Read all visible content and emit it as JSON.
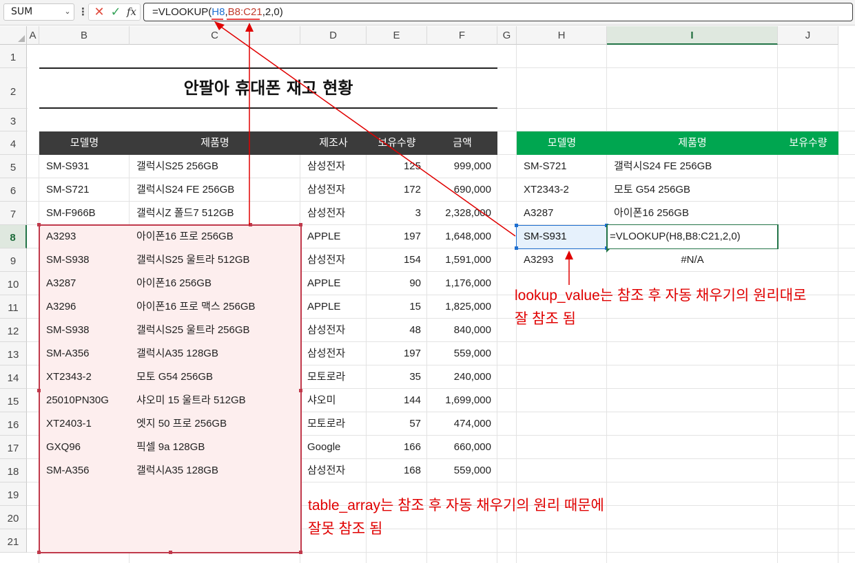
{
  "formula_bar": {
    "name_box": "SUM",
    "formula_prefix": "=VLOOKUP(",
    "ref_lookup": "H8",
    "comma1": ",",
    "ref_range": "B8:C21",
    "formula_suffix": ",2,0)"
  },
  "columns": [
    "A",
    "B",
    "C",
    "D",
    "E",
    "F",
    "G",
    "H",
    "I",
    "J"
  ],
  "rows": [
    "1",
    "2",
    "3",
    "4",
    "5",
    "6",
    "7",
    "8",
    "9",
    "10",
    "11",
    "12",
    "13",
    "14",
    "15",
    "16",
    "17",
    "18",
    "19",
    "20",
    "21"
  ],
  "title": "안팔아 휴대폰 재고 현황",
  "table1": {
    "headers": [
      "모델명",
      "제품명",
      "제조사",
      "보유수량",
      "금액"
    ],
    "rows": [
      [
        "SM-S931",
        "갤럭시S25 256GB",
        "삼성전자",
        "125",
        "999,000"
      ],
      [
        "SM-S721",
        "갤럭시S24 FE 256GB",
        "삼성전자",
        "172",
        "690,000"
      ],
      [
        "SM-F966B",
        "갤럭시Z 폴드7 512GB",
        "삼성전자",
        "3",
        "2,328,000"
      ],
      [
        "A3293",
        "아이폰16 프로 256GB",
        "APPLE",
        "197",
        "1,648,000"
      ],
      [
        "SM-S938",
        "갤럭시S25 울트라 512GB",
        "삼성전자",
        "154",
        "1,591,000"
      ],
      [
        "A3287",
        "아이폰16 256GB",
        "APPLE",
        "90",
        "1,176,000"
      ],
      [
        "A3296",
        "아이폰16 프로 맥스 256GB",
        "APPLE",
        "15",
        "1,825,000"
      ],
      [
        "SM-S938",
        "갤럭시S25 울트라 256GB",
        "삼성전자",
        "48",
        "840,000"
      ],
      [
        "SM-A356",
        "갤럭시A35 128GB",
        "삼성전자",
        "197",
        "559,000"
      ],
      [
        "XT2343-2",
        "모토 G54 256GB",
        "모토로라",
        "35",
        "240,000"
      ],
      [
        "25010PN30G",
        "샤오미 15 울트라 512GB",
        "샤오미",
        "144",
        "1,699,000"
      ],
      [
        "XT2403-1",
        "엣지 50 프로 256GB",
        "모토로라",
        "57",
        "474,000"
      ],
      [
        "GXQ96",
        "픽셀 9a 128GB",
        "Google",
        "166",
        "660,000"
      ],
      [
        "SM-A356",
        "갤럭시A35 128GB",
        "삼성전자",
        "168",
        "559,000"
      ]
    ]
  },
  "table2": {
    "headers": [
      "모델명",
      "제품명",
      "보유수량"
    ],
    "rows": [
      [
        "SM-S721",
        "갤럭시S24 FE 256GB",
        ""
      ],
      [
        "XT2343-2",
        "모토 G54 256GB",
        ""
      ],
      [
        "A3287",
        "아이폰16 256GB",
        ""
      ],
      [
        "SM-S931",
        "=VLOOKUP(H8,B8:C21,2,0)",
        ""
      ],
      [
        "A3293",
        "#N/A",
        ""
      ]
    ]
  },
  "annotations": {
    "lookup_line1": "lookup_value는 참조 후 자동 채우기의 원리대로",
    "lookup_line2": "잘 참조 됨",
    "table_line1": "table_array는 참조 후 자동 채우기의 원리 때문에",
    "table_line2": "잘못 참조 됨"
  },
  "colors": {
    "annotation": "#e00000",
    "table1_header_bg": "#3b3b3b",
    "table2_header_bg": "#00a650",
    "highlight_range_fill": "#fdeeee",
    "highlight_range_border": "#c0394b",
    "selected_cell_border": "#217346"
  }
}
